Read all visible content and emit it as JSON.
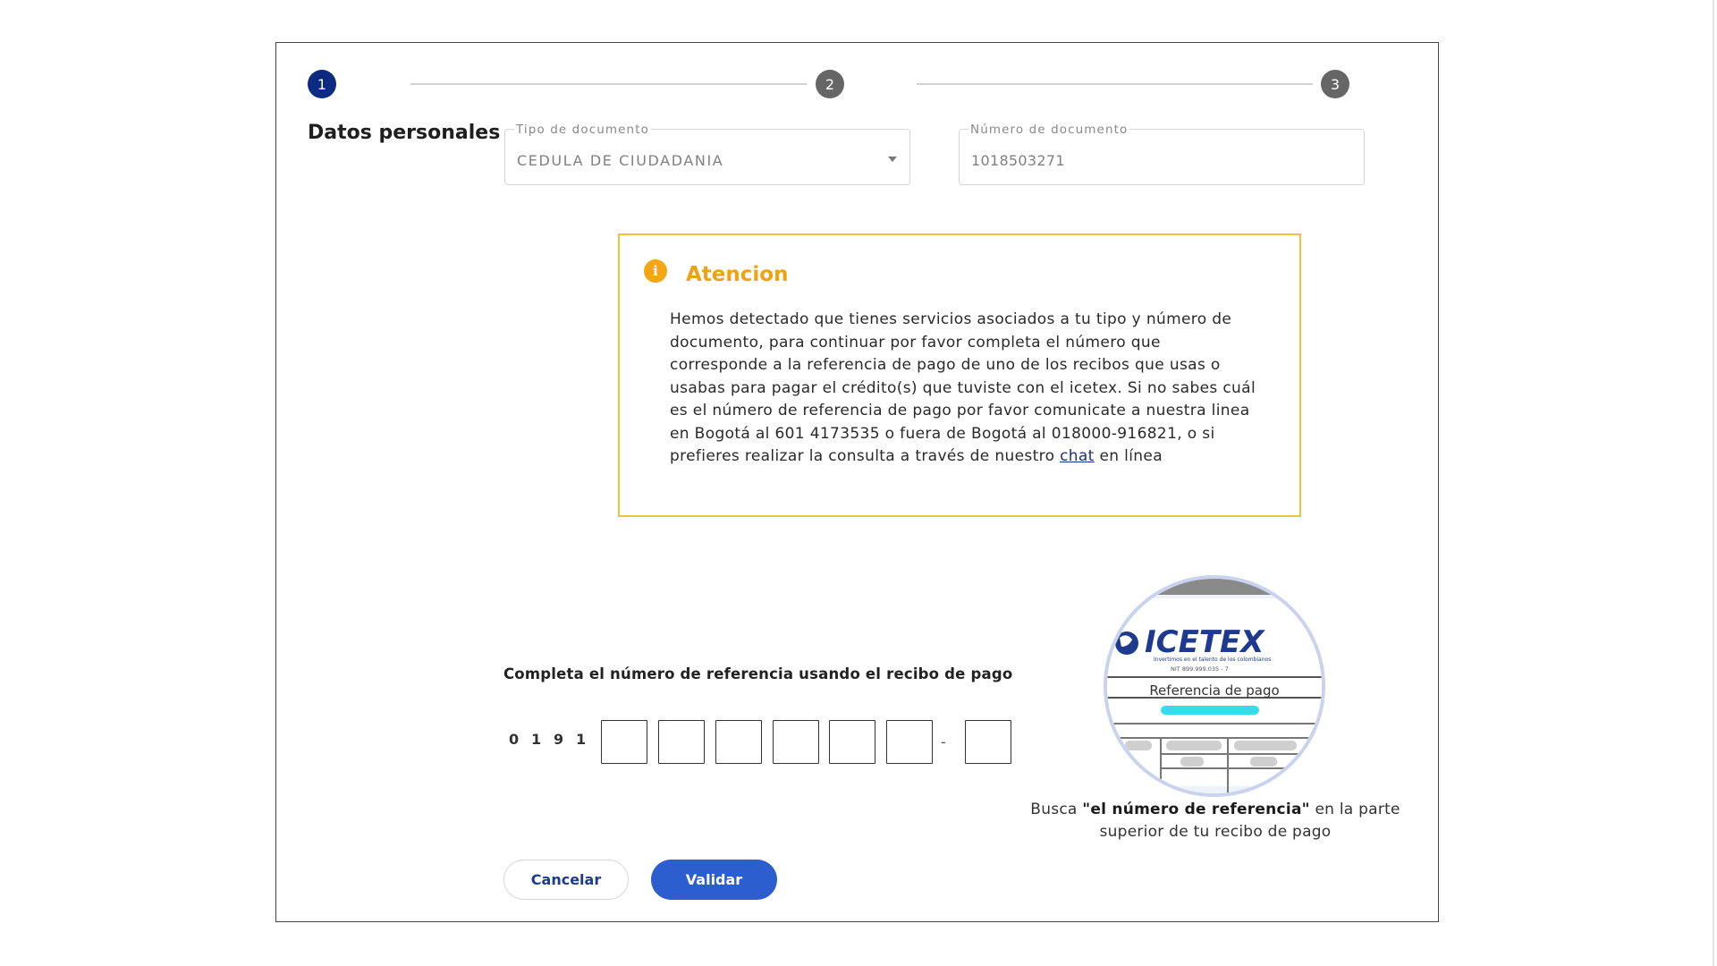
{
  "stepper": {
    "steps": [
      {
        "number": "1",
        "state": "active"
      },
      {
        "number": "2",
        "state": "inactive"
      },
      {
        "number": "3",
        "state": "inactive"
      }
    ],
    "active_color": "#0d2a82",
    "inactive_color": "#666666"
  },
  "section_title": "Datos personales",
  "document_type": {
    "label": "Tipo de documento",
    "value": "CEDULA DE CIUDADANIA"
  },
  "document_number": {
    "label": "Número de documento",
    "value": "1018503271"
  },
  "alert": {
    "icon": "info-icon",
    "icon_glyph": "i",
    "title": "Atencion",
    "body_before_link": "Hemos detectado que tienes servicios asociados a tu tipo y número de documento, para continuar por favor completa el número que corresponde a la referencia de pago de uno de los recibos que usas o usabas para pagar el crédito(s) que tuviste con el icetex. Si no sabes cuál es el número de referencia de pago por favor comunicate a nuestra linea en Bogotá al 601 4173535 o fuera de Bogotá al 018000-916821, o si prefieres realizar la consulta a través de nuestro",
    "link_text": "chat",
    "body_after_link": "en línea",
    "border_color": "#f4c23a",
    "title_color": "#f0a20f"
  },
  "reference": {
    "title": "Completa el número de referencia usando el recibo de pago",
    "prefix_digits": [
      "0",
      "1",
      "9",
      "1"
    ],
    "input_count": 6,
    "separator": "-",
    "check_digit_count": 1,
    "values": [
      "",
      "",
      "",
      "",
      "",
      "",
      ""
    ]
  },
  "receipt_image": {
    "logo_text": "ICETEX",
    "tagline": "Invertimos en el talento de los colombianos",
    "nit": "NIT 899.999.035 - 7",
    "field_label": "Referencia de pago",
    "highlight_color": "#34dcec"
  },
  "help_text": {
    "prefix": "Busca",
    "bold": "\"el número de referencia\"",
    "suffix": "en la parte superior de tu recibo de pago"
  },
  "buttons": {
    "cancel": "Cancelar",
    "validate": "Validar"
  },
  "colors": {
    "primary": "#2d5ed0",
    "dark_blue": "#1d3c8f"
  }
}
